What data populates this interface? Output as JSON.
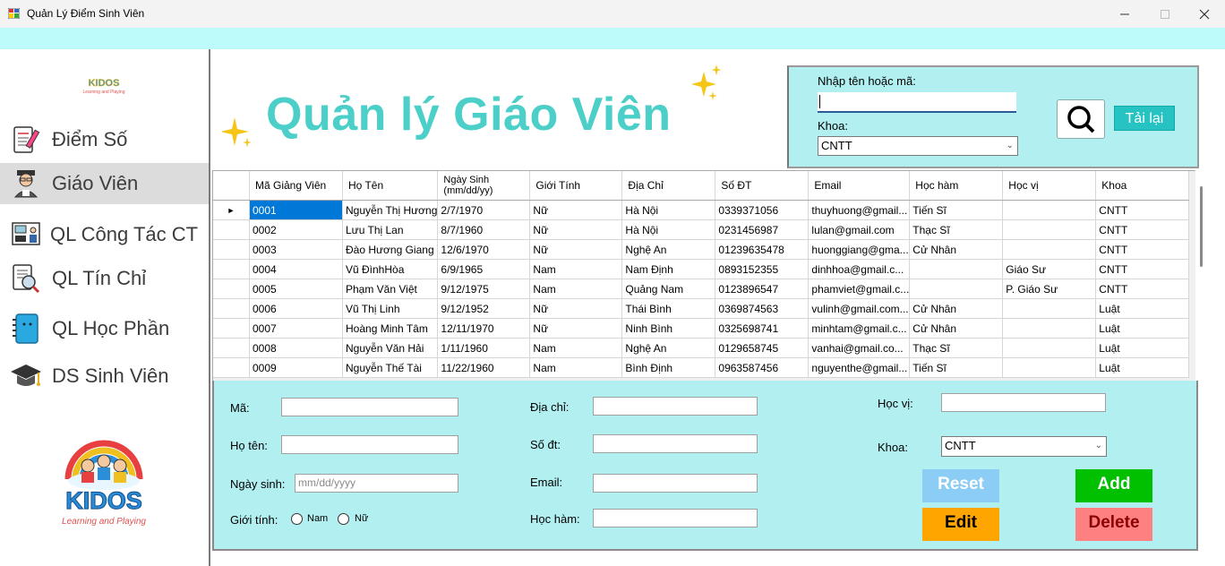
{
  "window": {
    "title": "Quản Lý Điểm Sinh Viên"
  },
  "sidebar": {
    "items": [
      {
        "label": "Điểm Số",
        "icon": "exam-paper-icon"
      },
      {
        "label": "Giáo Viên",
        "icon": "teacher-icon",
        "active": true
      },
      {
        "label": "QL Công Tác CT",
        "icon": "classroom-board-icon"
      },
      {
        "label": "QL Tín Chỉ",
        "icon": "document-search-icon"
      },
      {
        "label": "QL Học Phần",
        "icon": "notebook-icon"
      },
      {
        "label": "DS Sinh Viên",
        "icon": "graduation-cap-icon"
      }
    ],
    "logo_text": "KIDOS",
    "logo_tagline": "Learning and Playing"
  },
  "main": {
    "title": "Quản lý Giáo Viên"
  },
  "search": {
    "name_label": "Nhập tên hoặc mã:",
    "name_value": "",
    "dept_label": "Khoa:",
    "dept_value": "CNTT",
    "reload_label": "Tải lại"
  },
  "grid": {
    "columns": [
      "Mã Giảng Viên",
      "Họ Tên",
      "Ngày Sinh\n(mm/dd/yy)",
      "Giới Tính",
      "Địa Chỉ",
      "Số ĐT",
      "Email",
      "Học hàm",
      "Học vị",
      "Khoa"
    ],
    "rows": [
      [
        "0001",
        "Nguyễn Thị Hương",
        "2/7/1970",
        "Nữ",
        "Hà Nội",
        "0339371056",
        "thuyhuong@gmail...",
        "Tiến Sĩ",
        "",
        "CNTT"
      ],
      [
        "0002",
        "Lưu Thị Lan",
        "8/7/1960",
        "Nữ",
        "Hà Nội",
        "0231456987",
        "lulan@gmail.com",
        "Thạc Sĩ",
        "",
        "CNTT"
      ],
      [
        "0003",
        "Đào Hương Giang",
        "12/6/1970",
        "Nữ",
        "Nghệ An",
        "01239635478",
        "huonggiang@gma...",
        "Cử Nhân",
        "",
        "CNTT"
      ],
      [
        "0004",
        "Vũ ĐìnhHòa",
        "6/9/1965",
        "Nam",
        "Nam Định",
        "0893152355",
        "dinhhoa@gmail.c...",
        "",
        "Giáo Sư",
        "CNTT"
      ],
      [
        "0005",
        "Phạm Văn Việt",
        "9/12/1975",
        "Nam",
        "Quảng Nam",
        "0123896547",
        "phamviet@gmail.c...",
        "",
        "P. Giáo Sư",
        "CNTT"
      ],
      [
        "0006",
        "Vũ Thị Linh",
        "9/12/1952",
        "Nữ",
        "Thái Bình",
        "0369874563",
        "vulinh@gmail.com...",
        "Cử Nhân",
        "",
        "Luật"
      ],
      [
        "0007",
        "Hoàng Minh Tâm",
        "12/11/1970",
        "Nữ",
        "Ninh Bình",
        "0325698741",
        "minhtam@gmail.c...",
        "Cử Nhân",
        "",
        "Luật"
      ],
      [
        "0008",
        "Nguyễn Văn Hải",
        "1/11/1960",
        "Nam",
        "Nghệ An",
        "0129658745",
        "vanhai@gmail.co...",
        "Thạc Sĩ",
        "",
        "Luật"
      ],
      [
        "0009",
        "Nguyễn Thế Tài",
        "11/22/1960",
        "Nam",
        "Bình Định",
        "0963587456",
        "nguyenthe@gmail...",
        "Tiến Sĩ",
        "",
        "Luật"
      ]
    ],
    "row_marker": "►"
  },
  "form": {
    "ma_label": "Mã:",
    "ma_value": "",
    "hoten_label": "Họ tên:",
    "hoten_value": "",
    "ngaysinh_label": "Ngày sinh:",
    "ngaysinh_placeholder": "mm/dd/yyyy",
    "gioitinh_label": "Giới tính:",
    "gender_options": [
      "Nam",
      "Nữ"
    ],
    "diachi_label": "Địa chỉ:",
    "sodt_label": "Số đt:",
    "email_label": "Email:",
    "hocham_label": "Học hàm:",
    "hocvi_label": "Học vị:",
    "khoa_label": "Khoa:",
    "khoa_value": "CNTT",
    "buttons": {
      "reset": "Reset",
      "add": "Add",
      "edit": "Edit",
      "delete": "Delete"
    }
  },
  "colors": {
    "accent_title": "#4ccfc8",
    "panel_bg": "#b2eff0",
    "reset_btn": "#8ccdf5",
    "add_btn": "#00c000",
    "edit_btn": "#ffa500",
    "delete_btn": "#ff8080",
    "selection": "#0078d7"
  }
}
